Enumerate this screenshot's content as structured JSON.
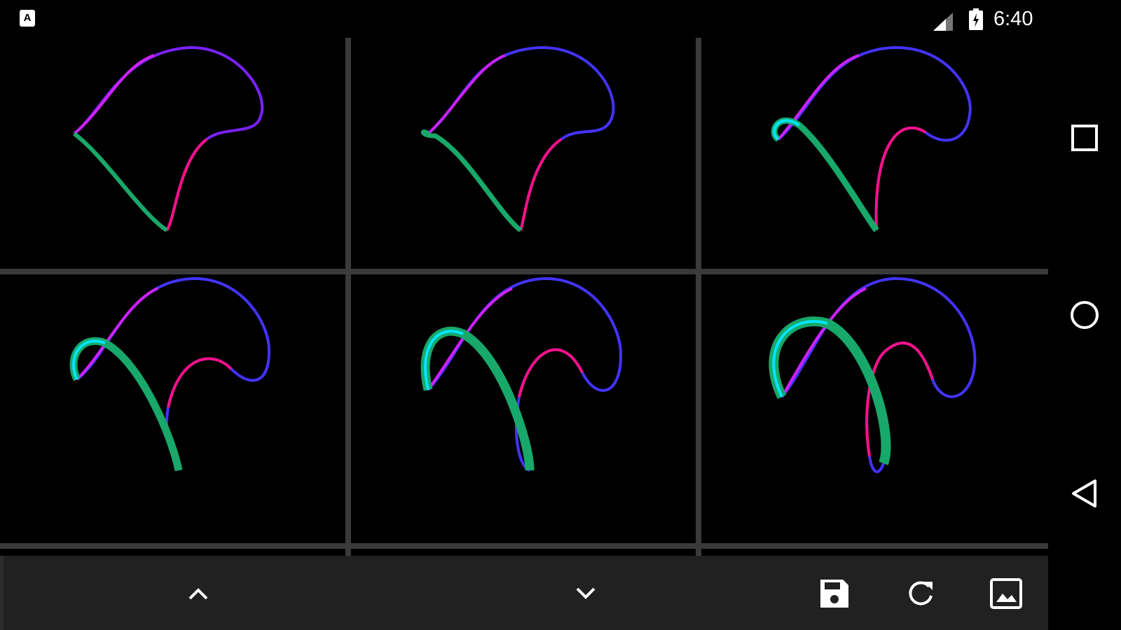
{
  "status_bar": {
    "time": "6:40",
    "notification_icon": "app-notification-icon",
    "signal_icon": "cell-signal-icon",
    "battery_icon": "battery-charging-icon"
  },
  "grid": {
    "rows": 2,
    "columns": 3,
    "cells": [
      {
        "id": 1,
        "shape": "curve-1"
      },
      {
        "id": 2,
        "shape": "curve-2"
      },
      {
        "id": 3,
        "shape": "curve-3"
      },
      {
        "id": 4,
        "shape": "curve-4"
      },
      {
        "id": 5,
        "shape": "curve-5"
      },
      {
        "id": 6,
        "shape": "curve-6"
      }
    ]
  },
  "bottom_bar": {
    "buttons": [
      {
        "name": "scroll-up-button",
        "icon": "chevron-up-icon"
      },
      {
        "name": "scroll-down-button",
        "icon": "chevron-down-icon"
      },
      {
        "name": "save-button",
        "icon": "save-icon"
      },
      {
        "name": "refresh-button",
        "icon": "refresh-icon"
      },
      {
        "name": "gallery-button",
        "icon": "image-icon"
      }
    ]
  },
  "nav_bar": {
    "buttons": [
      {
        "name": "recents-button",
        "icon": "square-icon"
      },
      {
        "name": "home-button",
        "icon": "circle-icon"
      },
      {
        "name": "back-button",
        "icon": "triangle-back-icon"
      }
    ]
  },
  "colors": {
    "background": "#000000",
    "divider": "#3a3a3a",
    "toolbar": "#212121",
    "curve_blue": "#2233ff",
    "curve_magenta": "#cc22ff",
    "curve_pink": "#ff1188",
    "curve_green": "#18a86a",
    "curve_cyan": "#00e5ff"
  }
}
